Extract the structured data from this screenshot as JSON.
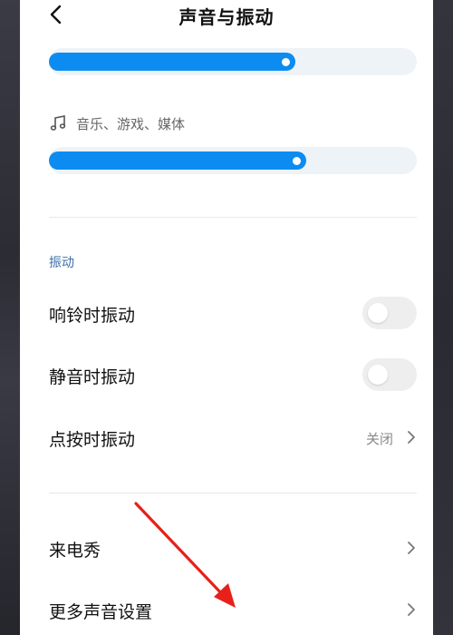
{
  "header": {
    "title": "声音与振动",
    "back_icon": "chevron-left-icon"
  },
  "sliders": [
    {
      "level": 0.67
    },
    {
      "label": "音乐、游戏、媒体",
      "icon": "music-note-icon",
      "level": 0.7
    }
  ],
  "vibration": {
    "section_title": "振动",
    "items": [
      {
        "label": "响铃时振动",
        "on": false
      },
      {
        "label": "静音时振动",
        "on": false
      },
      {
        "label": "点按时振动",
        "value": "关闭"
      }
    ]
  },
  "more": {
    "items": [
      {
        "label": "来电秀"
      },
      {
        "label": "更多声音设置"
      }
    ]
  },
  "colors": {
    "accent": "#0c8cf0",
    "annotation_arrow": "#e8201a"
  }
}
